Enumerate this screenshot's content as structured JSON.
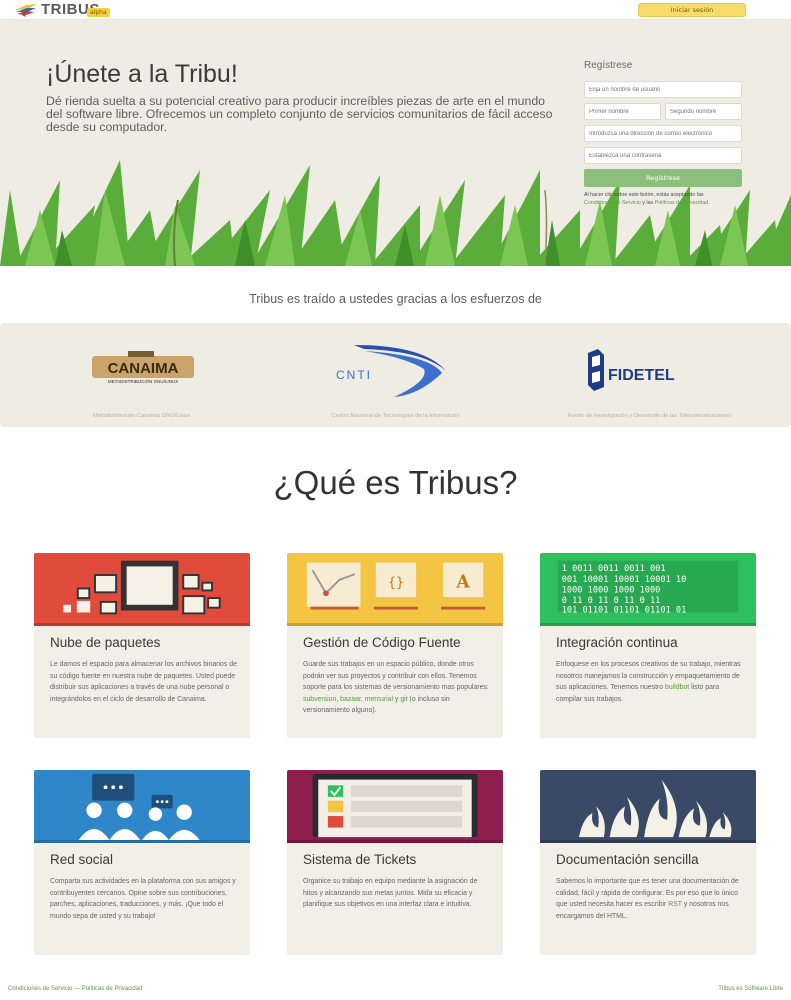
{
  "header": {
    "brand": "TRIBUS",
    "badge": "alpha",
    "login_label": "Iniciar sesión",
    "logo_icon": "bird-logo-icon"
  },
  "hero": {
    "title": "¡Únete a la Tribu!",
    "lead": "Dé rienda suelta a su potencial creativo para producir increíbles piezas de arte en el mundo del software libre. Ofrecemos un completo conjunto de servicios comunitarios de fácil acceso desde su computador."
  },
  "register": {
    "title": "Regístrese",
    "username_placeholder": "Elija un nombre de usuario",
    "firstname_placeholder": "Primer nombre",
    "lastname_placeholder": "Segundo nombre",
    "email_placeholder": "Introduzca una dirección de correo electrónico",
    "password_placeholder": "Establezca una contraseña",
    "submit_label": "Regístrese",
    "terms_prefix": "Al hacer clic sobre este botón, estás aceptando las",
    "terms_link": "Condiciones de Servicio",
    "terms_and": " y las ",
    "privacy_link": "Políticas de Privacidad",
    "terms_suffix": "."
  },
  "sponsors": {
    "title": "Tribus es traído a ustedes gracias a los esfuerzos de",
    "items": [
      {
        "logo_text": "CANAIMA",
        "logo_sub": "METADISTRIBUCIÓN GNU/LINUX",
        "caption": "Metadistribución Canaima GNU/Linux"
      },
      {
        "logo_text": "CNTI",
        "caption": "Centro Nacional de Tecnologías de la Información"
      },
      {
        "logo_text": "FIDETEL",
        "caption": "Fondo de Investigación y Desarrollo de las Telecomunicaciones"
      }
    ]
  },
  "features": {
    "title": "¿Qué es Tribus?",
    "cards": [
      {
        "title": "Nube de paquetes",
        "color": "#e04b3c",
        "text": "Le damos el espacio para almacenar los archivos binarios de su código fuente en nuestra nube de paquetes. Usted puede distribuir sus aplicaciones a través de una nube personal o integrándolos en el ciclo de desarrollo de Canaima."
      },
      {
        "title": "Gestión de Código Fuente",
        "color": "#f4c542",
        "text_before": "Guarde sus trabajos en un espacio público, donde otros podrán ver sus proyectos y contribuir con ellos. Tenemos soporte para los sistemas de versionamiento mas populares: ",
        "link1": "subversion",
        "sep1": ", ",
        "link2": "bazaar",
        "sep2": ", ",
        "link3": "mercurial",
        "sep3": " y ",
        "link4": "git",
        "text_after": " (o incluso sin versionamiento alguno)."
      },
      {
        "title": "Integración continua",
        "color": "#2ec05d",
        "text_before": "Enfoquese en los procesos creativos de su trabajo, mientras nosotros manejamos la construcción y empaquetamiento de sus aplicaciones. Tenemos nuestro ",
        "link1": "buildbot",
        "text_after": " listo para compilar sus trabajos.",
        "binary": [
          "1   0011   0011   0011   001",
          "001  10001  10001  10001  10",
          " 1000   1000   1000   1000",
          "0   11   0   11   0   11   0   11",
          "101  01101  01101  01101  01"
        ]
      },
      {
        "title": "Red social",
        "color": "#2f86c9",
        "text": "Comparta sus actividades en la plataforma con sus amigos y contribuyentes cercanos. Opine sobre sus contribuciones, parches, aplicaciones, traducciones, y más. ¡Que todo el mundo sepa de usted y su trabajo!"
      },
      {
        "title": "Sistema de Tickets",
        "color": "#8e1e4f",
        "text": "Organice su trabajo en equipo mediante la asignación de hitos y alcanzando sus metas juntos. Mida su eficacia y planifique sus objetivos en una interfaz clara e intuitiva."
      },
      {
        "title": "Documentación sencilla",
        "color": "#394a66",
        "text_before": "Sabemos lo importante que es tener una documentación de calidad, fácil y rápida de configurar. Es por eso que lo único que usted necesita hacer es escribir ",
        "link1": "RST",
        "text_after": " y nosotros nos encargamos del HTML."
      }
    ]
  },
  "footer": {
    "terms": "Condiciones de Servicio",
    "sep": " — ",
    "privacy": "Políticas de Privacidad",
    "right": "Tribus es Software Libre"
  }
}
